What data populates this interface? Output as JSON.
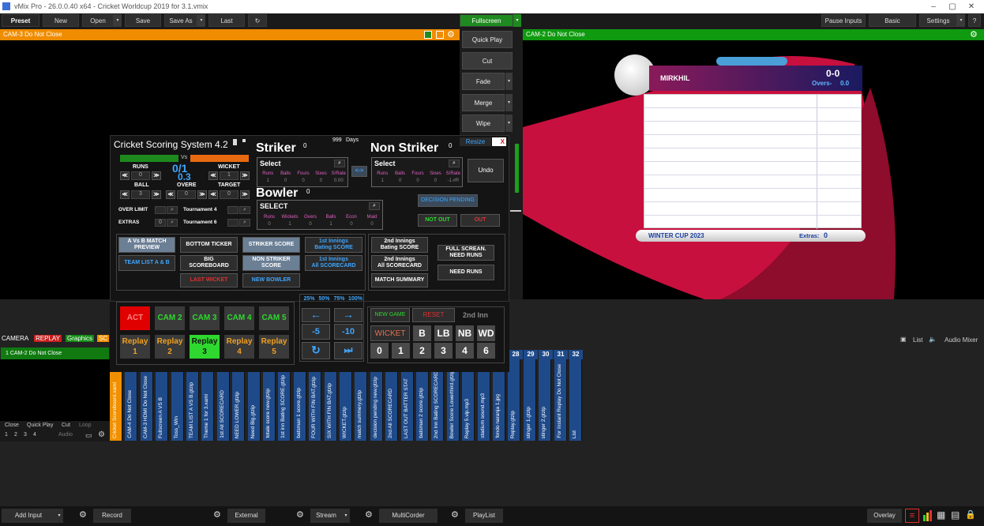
{
  "window": {
    "title": "vMix Pro - 26.0.0.40 x64 - Cricket Worldcup 2019 for 3.1.vmix"
  },
  "toolbar": {
    "preset": "Preset",
    "new": "New",
    "open": "Open",
    "save": "Save",
    "save_as": "Save As",
    "last": "Last",
    "fullscreen": "Fullscreen",
    "pause_inputs": "Pause Inputs",
    "basic": "Basic",
    "settings": "Settings",
    "help": "?"
  },
  "preview": {
    "title": "CAM-3 Do Not Close"
  },
  "program": {
    "title": "CAM-2 Do Not Close"
  },
  "transitions": [
    "Quick Play",
    "Cut",
    "Fade",
    "Merge",
    "Wipe"
  ],
  "overlay": {
    "batter": "MIRKHIL",
    "score": "0-0",
    "overs_label": "Overs-",
    "overs": "0.0",
    "tournament": "WINTER CUP 2023",
    "extras_label": "Extras:",
    "extras": "0"
  },
  "scoring": {
    "title": "Cricket Scoring System 4.2",
    "days_value": "999",
    "days_label": "Days",
    "vs": "Vs",
    "runs_label": "RUNS",
    "wicket_label": "WICKET",
    "runs_wicket": "0/1",
    "overs_value": "0.3",
    "ball_label": "BALL",
    "overe_label": "OVERE",
    "target_label": "TARGET",
    "runs_val": "0",
    "wicket_val": "1",
    "ball_val": "3",
    "over_val": "0",
    "target_val": "0",
    "over_limit_label": "OVER LIMIT",
    "extras_label": "EXTRAS",
    "extras_val": "0",
    "tournament4": "Tournament 4",
    "tournament6": "Tournament 6",
    "striker": "Striker",
    "striker_sup": "0",
    "striker_select": "Select",
    "non_striker": "Non Striker",
    "non_striker_sup": "0",
    "non_striker_select": "Select",
    "bowler": "Bowler",
    "bowler_sup": "0",
    "bowler_select": "SELECT",
    "bat_cols": [
      "Runs",
      "Balls",
      "Fours",
      "Sixes",
      "S/Rate"
    ],
    "bat_vals": [
      "1",
      "0",
      "0",
      "0",
      "0.00"
    ],
    "ns_vals": [
      "1",
      "0",
      "0",
      "0",
      "-1.#R"
    ],
    "bowl_cols": [
      "Runs",
      "Wickets",
      "Overs",
      "Balls",
      "Econ",
      "Maid"
    ],
    "bowl_vals": [
      "0",
      "1",
      "0",
      "1",
      "0",
      "0"
    ],
    "swap": "<->",
    "undo": "Undo",
    "resize": "Resize",
    "close": "X",
    "decision_pending": "DECISION PENDING",
    "not_out": "NOT OUT",
    "out": "OUT",
    "buttons": {
      "a_vs_b": "A Vs B MATCH\nPREVIEW",
      "bottom_ticker": "BOTTOM TICKER",
      "striker_score": "STRIKER SCORE",
      "first_bat": "1st Innings\nBating SCORE",
      "second_bat": "2nd Innings\nBating SCORE",
      "full_screen": "FULL SCREAN.\nNEED RUNS",
      "team_list": "TEAM LIST A & B",
      "big_scoreboard": "BIG\nSCOREBOARD",
      "non_striker_score": "NON STRIKER\nSCORE",
      "first_all": "1st Innings\nAll SCORECARD",
      "second_all": "2nd Innings\nAll SCORECARD",
      "need_runs": "NEED RUNS",
      "last_wicket": "LAST WICKET",
      "new_bowler": "NEW BOWLER",
      "match_summary": "MATCH SUMMARY"
    },
    "act": "ACT",
    "cams": [
      "CAM 2",
      "CAM 3",
      "CAM 4",
      "CAM 5"
    ],
    "replays": [
      "Replay\n1",
      "Replay\n2",
      "Replay\n3",
      "Replay\n4",
      "Replay\n5"
    ],
    "speeds": [
      "25%",
      "50%",
      "75%",
      "100%"
    ],
    "minus5": "-5",
    "minus10": "-10",
    "new_game": "NEW GAME",
    "reset": "RESET",
    "second_inn": "2nd Inn",
    "wicket": "WICKET",
    "extras_btn": [
      "B",
      "LB",
      "NB",
      "WD"
    ],
    "runs_btns": [
      "0",
      "1",
      "2",
      "3",
      "4",
      "6"
    ]
  },
  "lists": {
    "tabs": [
      "CAMERA",
      "REPLAY",
      "Graphics",
      "SC"
    ],
    "item": "1   CAM-2 Do Not Close",
    "close": "Close",
    "quick_play": "Quick Play",
    "cut": "Cut",
    "loop": "Loop",
    "audio": "Audio",
    "nums": [
      "1",
      "2",
      "3",
      "4"
    ],
    "list": "List",
    "audio_mixer": "Audio Mixer"
  },
  "strip_numbers": [
    "28",
    "29",
    "30",
    "31",
    "32"
  ],
  "strips": [
    "Cricket Scoreboard.xaml",
    "CAM-4 Do Not Close",
    "CAM-3 HDMI Do Not Close",
    "Fullscreen A VS B",
    "Toss_Win",
    "TEAM LIST A VS B.gtzip",
    "Theme 1 for 3.xaml",
    "1st All SCORECARD",
    "NEED LOWER.gtzip",
    "Need Big.gtzip",
    "totale score new.gtzip",
    "1st inn Bating SCORE.gtzip",
    "batsman 1 score.gtzip",
    "FOUR WITH FIN BAT.gtzip",
    "SIX WITH FIN BAT.gtzip",
    "WICKET.gtzip",
    "match summery.gtzip",
    "decision pending new.gtzip",
    "2nd All SCORECARD",
    "LAST OUT BATTER STAT",
    "batsman 2 score.gtzip",
    "2nd Inn Bating SCORECARD",
    "Bowler Score Lowerthird.gtzip",
    "Replay 5.vip.mp3",
    "stadium sound.mp3",
    "fondo naranja 1.jpg",
    "Replay.gtzip",
    "stinger 1.gtzip",
    "stinger 2.gtzip",
    "For Instant Replay Do Not Close",
    "List"
  ],
  "bottom": {
    "add_input": "Add Input",
    "record": "Record",
    "external": "External",
    "stream": "Stream",
    "multicorder": "MultiCorder",
    "playlist": "PlayList",
    "overlay": "Overlay"
  }
}
